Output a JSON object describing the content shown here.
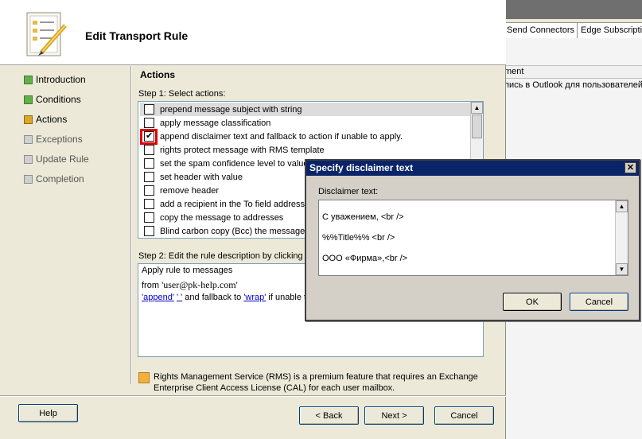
{
  "background_window": {
    "tabs": [
      "Send Connectors",
      "Edge Subscriptio"
    ],
    "column_header": "ment",
    "row_text": "пись в Outlook для пользователей"
  },
  "wizard": {
    "title": "Edit Transport Rule",
    "nav": [
      {
        "label": "Introduction",
        "state": "done"
      },
      {
        "label": "Conditions",
        "state": "done"
      },
      {
        "label": "Actions",
        "state": "current"
      },
      {
        "label": "Exceptions",
        "state": "todo"
      },
      {
        "label": "Update Rule",
        "state": "todo"
      },
      {
        "label": "Completion",
        "state": "todo"
      }
    ],
    "section_title": "Actions",
    "step1_label": "Step 1: Select actions:",
    "actions": [
      {
        "label": "prepend message subject with string",
        "checked": false
      },
      {
        "label": "apply message classification",
        "checked": false
      },
      {
        "label": "append disclaimer text and fallback to action if unable to apply.",
        "checked": true
      },
      {
        "label": "rights protect message with RMS template",
        "checked": false
      },
      {
        "label": "set the spam confidence level to value",
        "checked": false
      },
      {
        "label": "set header with value",
        "checked": false
      },
      {
        "label": "remove header",
        "checked": false
      },
      {
        "label": "add a recipient in the To field addresses",
        "checked": false
      },
      {
        "label": "copy the message to addresses",
        "checked": false
      },
      {
        "label": "Blind carbon copy (Bcc) the message t",
        "checked": false
      }
    ],
    "step2_label": "Step 2: Edit the rule description by clicking a",
    "description": {
      "line1": "Apply rule to messages",
      "from_prefix": "from",
      "from_value": "'user@pk-help.com'",
      "append_link": "'append'",
      "quote_link": "' '",
      "fallback_text": " and fallback to ",
      "wrap_link": "'wrap'",
      "tail_text": " if unable to"
    },
    "rms_note": "Rights Management Service (RMS) is a premium feature that requires an Exchange Enterprise Client Access License (CAL) for each user mailbox.",
    "buttons": {
      "help": "Help",
      "back": "< Back",
      "next": "Next >",
      "cancel": "Cancel"
    }
  },
  "dialog": {
    "title": "Specify disclaimer text",
    "label": "Disclaimer text:",
    "text_lines": [
      "С уважением, <br />",
      "%%Title%% <br />",
      "ООО «Фирма»,<br />"
    ],
    "ok": "OK",
    "cancel": "Cancel"
  }
}
